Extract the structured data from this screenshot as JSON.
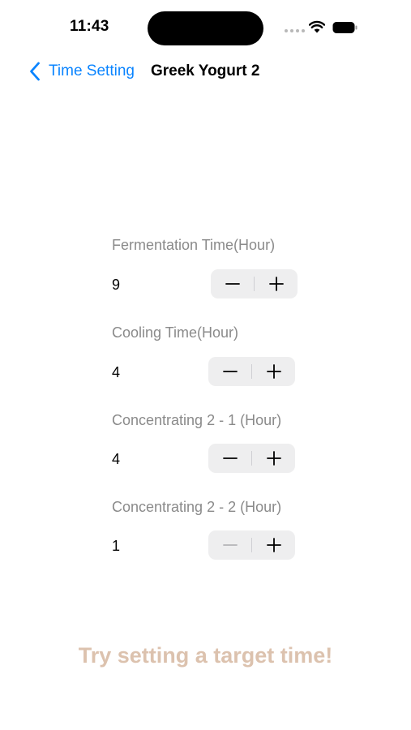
{
  "status_bar": {
    "time": "11:43",
    "icons": [
      "cellular-dots-icon",
      "wifi-icon",
      "battery-icon"
    ]
  },
  "nav": {
    "back_label": "Time Setting",
    "title": "Greek Yogurt 2",
    "back_icon": "chevron-left-icon",
    "accent_color": "#0a84ff"
  },
  "settings": [
    {
      "label": "Fermentation Time(Hour)",
      "value": "9",
      "minus_enabled": true
    },
    {
      "label": "Cooling Time(Hour)",
      "value": "4",
      "minus_enabled": true
    },
    {
      "label": "Concentrating 2 - 1 (Hour)",
      "value": "4",
      "minus_enabled": true
    },
    {
      "label": "Concentrating 2 - 2 (Hour)",
      "value": "1",
      "minus_enabled": false
    }
  ],
  "prompt": {
    "text": "Try setting a target time!",
    "color": "#dcc2ae"
  }
}
